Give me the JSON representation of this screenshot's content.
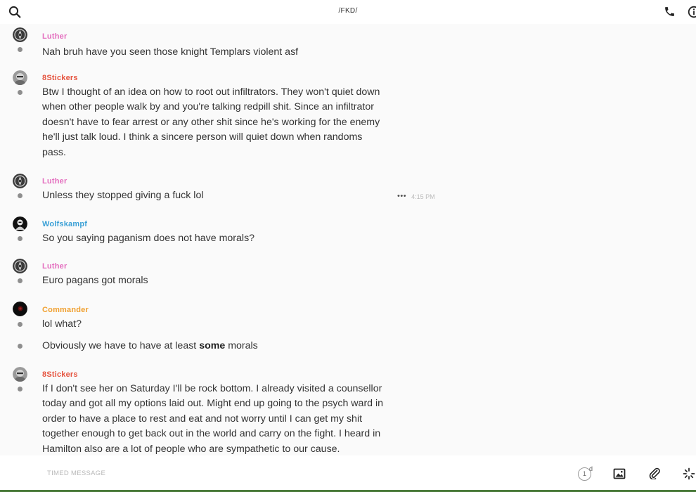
{
  "header": {
    "title": "/FKD/",
    "icons": [
      "search-icon",
      "phone-icon",
      "info-icon"
    ]
  },
  "messages": [
    {
      "sender": "Luther",
      "sender_color": "#e46fbf",
      "avatar": "luther-avatar",
      "lines": [
        "Nah bruh have you seen those knight Templars violent asf"
      ]
    },
    {
      "sender": "8Stickers",
      "sender_color": "#e5533e",
      "avatar": "8stickers-avatar",
      "lines": [
        "Btw I thought of an idea on how to root out infiltrators. They won't quiet down",
        "when other people walk by and you're talking redpill shit. Since an infiltrator",
        "doesn't have to fear arrest or any other shit since he's working for the enemy",
        "he'll just talk loud. I think a sincere person will quiet down when randoms",
        "pass."
      ]
    },
    {
      "sender": "Luther",
      "sender_color": "#e46fbf",
      "avatar": "luther-avatar",
      "lines": [
        "Unless they stopped giving a fuck lol"
      ],
      "more": "•••",
      "time": "4:15 PM"
    },
    {
      "sender": "Wolfskampf",
      "sender_color": "#3aa0d6",
      "avatar": "wolfskampf-avatar",
      "lines": [
        "So you saying paganism does not have morals?"
      ]
    },
    {
      "sender": "Luther",
      "sender_color": "#e46fbf",
      "avatar": "luther-avatar",
      "lines": [
        "Euro pagans got morals"
      ]
    },
    {
      "sender": "Commander",
      "sender_color": "#f0a030",
      "avatar": "commander-avatar",
      "lines": [
        "lol what?"
      ]
    },
    {
      "continuation": true,
      "text_before": "Obviously we have to have at least ",
      "text_bold": "some",
      "text_after": " morals"
    },
    {
      "sender": "8Stickers",
      "sender_color": "#e5533e",
      "avatar": "8stickers-avatar",
      "lines": [
        "If I don't see her on Saturday I'll be rock bottom. I already visited a counsellor",
        "today and got all my options laid out. Might end up going to the psych ward in",
        "order to have a place to rest and eat and not worry until I can get my shit",
        "together enough to get back out in the world and carry on the fight. I heard in",
        "Hamilton also are a lot of people who are sympathetic to our cause."
      ]
    }
  ],
  "composer": {
    "placeholder": "TIMED MESSAGE",
    "timer_value": "1",
    "timer_unit": "d",
    "icons": [
      "image-icon",
      "paperclip-icon",
      "sparkle-icon"
    ]
  }
}
